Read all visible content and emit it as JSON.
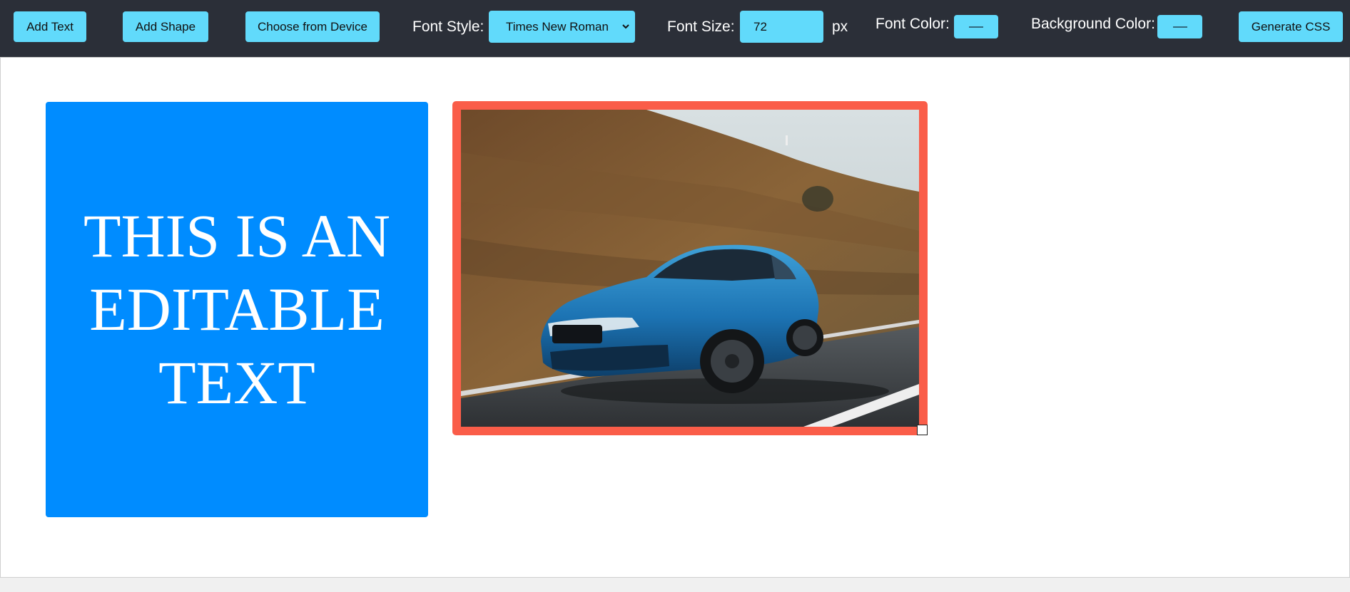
{
  "toolbar": {
    "add_text_label": "Add Text",
    "add_shape_label": "Add Shape",
    "choose_device_label": "Choose from Device",
    "font_style_label": "Font Style:",
    "font_style_value": "Times New Roman",
    "font_size_label": "Font Size:",
    "font_size_value": "72",
    "font_size_unit": "px",
    "font_color_label": "Font Color:",
    "background_color_label": "Background Color:",
    "generate_css_label": "Generate CSS"
  },
  "canvas": {
    "text_element": {
      "text": "THIS IS AN EDITABLE TEXT",
      "background": "#008cff",
      "color": "#ffffff"
    },
    "image_element": {
      "border_color": "#fa5d49",
      "description_icon": "blue-car-photo"
    }
  },
  "colors": {
    "toolbar_bg": "#2b2f38",
    "button_bg": "#61dafb",
    "canvas_bg": "#ffffff"
  }
}
